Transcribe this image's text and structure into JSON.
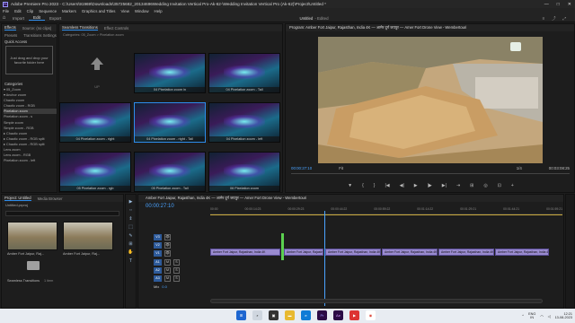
{
  "window": {
    "app_icon": "Pr",
    "title": "Adobe Premiere Pro 2023 - C:\\Users\\91969\\Downloads\\35725682_20134696Wedding Invitation Vertical Pro-Ak-62-\\Wedding Invitation Vertical Pro (Ak-62)\\Project\\Untitled *",
    "minimize": "—",
    "maximize": "□",
    "close": "✕"
  },
  "menu": [
    "File",
    "Edit",
    "Clip",
    "Sequence",
    "Markers",
    "Graphics and Titles",
    "View",
    "Window",
    "Help"
  ],
  "workspaces": {
    "tabs": [
      "Import",
      "Edit",
      "Export"
    ],
    "active": "Edit",
    "project_name": "Untitled",
    "edited": "- Edited"
  },
  "effects_panel": {
    "tabs": [
      "Effects",
      "Source: (no clips)",
      "Lumetri Scopes"
    ],
    "subtabs": [
      "Presets",
      "Transitions Settings"
    ],
    "quick_access": "Quick Access",
    "drop_hint": "Just drag and drop your favorite folder here",
    "categories_label": "Categories",
    "tree": [
      "▾ 05_Zoom",
      "  ▾ Anchor zoom",
      "     Chaotic zoom",
      "     Chaotic zoom - RGB",
      "     Pixelation zoom",
      "     Pixelation zoom - s",
      "     Simple zoom",
      "     Simple zoom - RGB",
      "  ▸ Chaotic zoom",
      "  ▸ Chaotic zoom - RGB split",
      "  ▸ Chaotic zoom - RGB split",
      "     Lens zoom",
      "     Lens zoom - RGB",
      "     Pixelation zoom - left",
      "     Pixelation zoom - right",
      "     Simple zoom - RGB"
    ]
  },
  "browser": {
    "tabs": [
      "Seamless Transitions",
      "Effect Controls"
    ],
    "path": "Categories: 05_Zoom > Pixelation zoom",
    "up_label": "UP",
    "thumbs": [
      "04 Pixelation zoom in",
      "04 Pixelation zoom - Tall",
      "04 Pixelation zoom - right",
      "04 Pixelation zoom - right - Tall",
      "04 Pixelation zoom - left",
      "05 Pixelation zoom - rgb",
      "05 Pixelation zoom - Tall",
      "06 Pixelation zoom"
    ]
  },
  "program": {
    "title": "Program: Amber Fort Jaipur, Rajasthan, India 4K — आमेर दुर्ग जयपुर — Amer Fort Drone View - Wembertouri",
    "timecode": "00:00:27:10",
    "fit": "Fit",
    "quality": "1/4",
    "duration": "00:03:08:25",
    "transport": [
      "▼",
      "{",
      "}",
      "|◀",
      "◀|",
      "▶",
      "|▶",
      "▶|",
      "⇥",
      "⊞",
      "◎",
      "⊡",
      "+"
    ]
  },
  "project": {
    "tabs": [
      "Project: Untitled",
      "Media Browser"
    ],
    "name": "Untitled.prproj",
    "items": [
      {
        "label": "Amber Fort Jaipur, Raj...",
        "duration": "3:08:25"
      },
      {
        "label": "Amber Fort Jaipur, Raj...",
        "duration": "3:08:25"
      },
      {
        "label": "Seamless Transitions",
        "duration": "1 item"
      }
    ]
  },
  "tools": [
    "▶",
    "⇔",
    "⇕",
    "⬚",
    "✎",
    "⊞",
    "✋",
    "T"
  ],
  "timeline": {
    "sequence": "Amber Fort Jaipur, Rajasthan, India 4K — आमेर दुर्ग जयपुर — Amer Fort Drone View - Wembertouri",
    "timecode": "00:00:27:10",
    "ruler": [
      "00:00",
      "00:00:14:23",
      "00:00:29:23",
      "00:00:44:22",
      "00:00:59:22",
      "00:01:14:22",
      "00:01:29:21",
      "00:01:44:21",
      "00:01:59:21"
    ],
    "tracks": [
      {
        "name": "V3",
        "type": "video"
      },
      {
        "name": "V2",
        "type": "video"
      },
      {
        "name": "V1",
        "type": "video"
      },
      {
        "name": "A1",
        "type": "audio"
      },
      {
        "name": "A2",
        "type": "audio"
      },
      {
        "name": "A3",
        "type": "audio"
      },
      {
        "name": "Mix",
        "type": "mix",
        "value": "0.0"
      }
    ],
    "clip_label": "Amber Fort Jaipur, Rajasthan, India 4K"
  },
  "taskbar": {
    "search": "",
    "lang": "ENG",
    "region": "IN",
    "time": "12:21",
    "date": "13-08-2023"
  }
}
